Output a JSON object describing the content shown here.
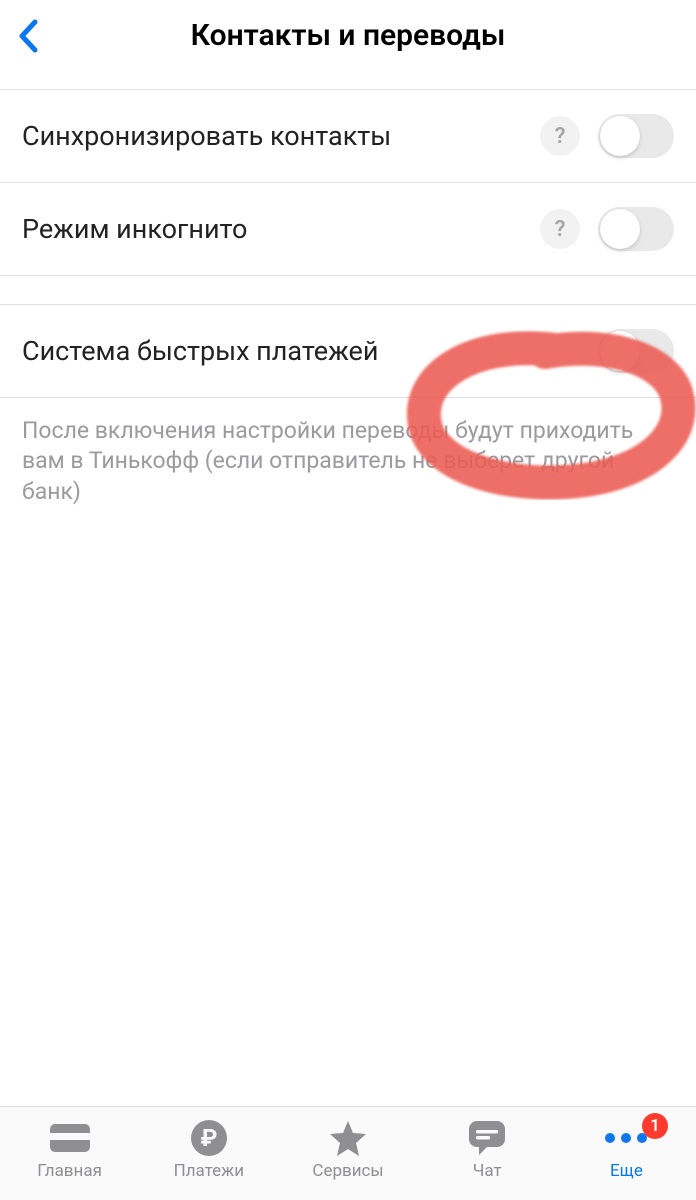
{
  "header": {
    "title": "Контакты и переводы"
  },
  "settings": {
    "sync_contacts": {
      "label": "Синхронизировать контакты",
      "has_help": true
    },
    "incognito": {
      "label": "Режим инкогнито",
      "has_help": true
    },
    "fast_payments": {
      "label": "Система быстрых платежей",
      "has_help": false
    }
  },
  "description": "После включения настройки переводы будут приходить вам в Тинькофф (если отправитель не выберет другой банк)",
  "help_symbol": "?",
  "tabbar": {
    "home": "Главная",
    "payments": "Платежи",
    "services": "Сервисы",
    "chat": "Чат",
    "more": "Еще",
    "badge": "1"
  }
}
